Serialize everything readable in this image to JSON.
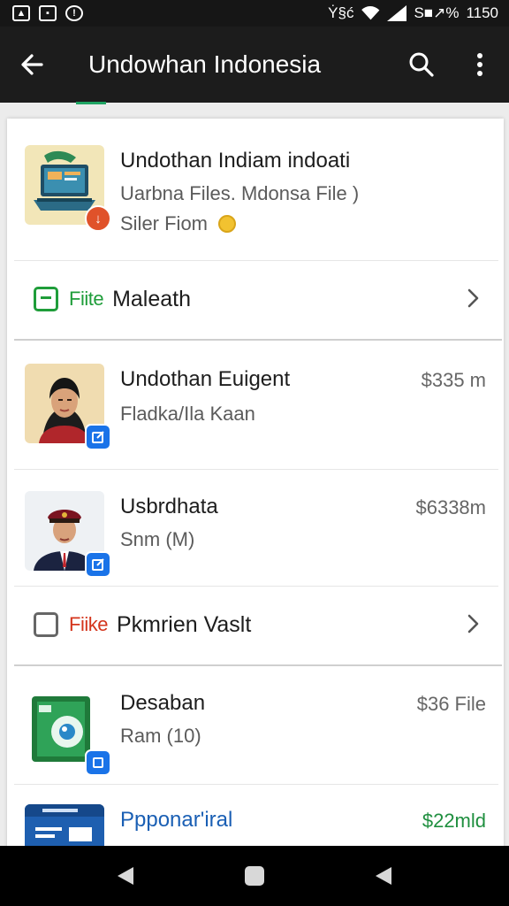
{
  "status_bar": {
    "right_text": "Ẏ§ć",
    "battery_text": "S■↗%",
    "time": "1150"
  },
  "app_bar": {
    "title": "Undowhan Indonesia",
    "back_icon": "arrow-left-icon",
    "search_icon": "search-icon",
    "menu_icon": "overflow-menu-icon"
  },
  "accent_color": "#1fa463",
  "header_item": {
    "title": "Undothan Indiam indoati",
    "subtitle": "Uarbna Files. Mdonsa File )",
    "meta": "Siler Fiom",
    "meta_icon": "coin-icon"
  },
  "sections": [
    {
      "tag": "Fiite",
      "label": "Maleath",
      "tag_color": "#1f9d3a",
      "icon": "green-square-icon"
    },
    {
      "tag": "Fiike",
      "label": "Pkmrien Vaslt",
      "tag_color": "#d4351c",
      "icon": "checkbox-outline-icon"
    }
  ],
  "items": [
    {
      "title": "Undothan Euigent",
      "subtitle": "Fladka/Ila Kaan",
      "price": "$335 m"
    },
    {
      "title": "Usbrdhata",
      "subtitle": "Snm (M)",
      "price": "$6338m"
    },
    {
      "title": "Desaban",
      "subtitle": "Ram (10)",
      "price": "$36 File"
    },
    {
      "title": "Ppponar'iral",
      "subtitle": "",
      "price": "$22mld"
    }
  ]
}
